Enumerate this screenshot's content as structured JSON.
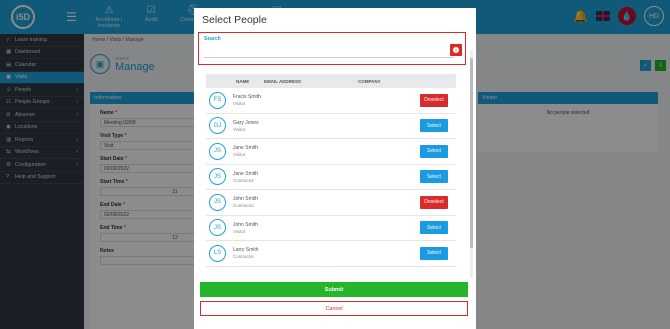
{
  "topbar": {
    "logo": "i5D",
    "nav": [
      {
        "icon": "accident-icon",
        "label": "Accidents / Incidents"
      },
      {
        "icon": "audit-icon",
        "label": "Audit"
      },
      {
        "icon": "contractor-icon",
        "label": "Contractor"
      },
      {
        "icon": "people-icon",
        "label": ""
      },
      {
        "icon": "chart-icon",
        "label": ""
      }
    ],
    "avatar": "HD"
  },
  "sidebar": {
    "items": [
      {
        "icon": "graduation-cap-icon",
        "label": "Learn training",
        "active": false,
        "caret": false
      },
      {
        "icon": "dashboard-icon",
        "label": "Dashboard",
        "active": false,
        "caret": false
      },
      {
        "icon": "calendar-icon",
        "label": "Calendar",
        "active": false,
        "caret": false
      },
      {
        "icon": "visits-icon",
        "label": "Visits",
        "active": true,
        "caret": false
      },
      {
        "icon": "people-icon",
        "label": "People",
        "active": false,
        "caret": true
      },
      {
        "icon": "people-groups-icon",
        "label": "People Groups",
        "active": false,
        "caret": true
      },
      {
        "icon": "absence-icon",
        "label": "Absence",
        "active": false,
        "caret": true
      },
      {
        "icon": "location-icon",
        "label": "Locations",
        "active": false,
        "caret": false
      },
      {
        "icon": "reports-icon",
        "label": "Reports",
        "active": false,
        "caret": true
      },
      {
        "icon": "workflow-icon",
        "label": "Workflows",
        "active": false,
        "caret": true
      },
      {
        "icon": "configuration-icon",
        "label": "Configuration",
        "active": false,
        "caret": true
      },
      {
        "icon": "help-icon",
        "label": "Help and Support",
        "active": false,
        "caret": false
      }
    ]
  },
  "breadcrumb": "Home / Visits / Manage",
  "page": {
    "subtitle": "VISITS",
    "title": "Manage"
  },
  "info_panel": {
    "header": "Information",
    "fields": [
      {
        "label": "Name",
        "required": true,
        "value": "Meeting 02/09"
      },
      {
        "label": "Visit Type",
        "required": true,
        "value": "Visit"
      },
      {
        "label": "Start Date",
        "required": true,
        "value": "02/09/2022"
      },
      {
        "label": "Start Time",
        "required": true,
        "value": "11"
      },
      {
        "label": "End Date",
        "required": true,
        "value": "02/09/2022"
      },
      {
        "label": "End Time",
        "required": true,
        "value": "12"
      },
      {
        "label": "Notes",
        "required": false,
        "value": ""
      }
    ]
  },
  "visitors_panel": {
    "header": "Visitor",
    "empty_text": "No people selected"
  },
  "modal": {
    "title": "Select People",
    "search": {
      "label": "Search",
      "placeholder": "",
      "value": ""
    },
    "columns": [
      "NAME",
      "EMAIL ADDRESS",
      "COMPANY"
    ],
    "people": [
      {
        "initials": "FS",
        "name": "Fracis Smith",
        "role": "Visitor",
        "action": "Deselect"
      },
      {
        "initials": "GJ",
        "name": "Gary Jones",
        "role": "Visitor",
        "action": "Select"
      },
      {
        "initials": "JS",
        "name": "Jane Smith",
        "role": "Visitor",
        "action": "Select"
      },
      {
        "initials": "JS",
        "name": "Jane Smith",
        "role": "Contractor",
        "action": "Select"
      },
      {
        "initials": "JS",
        "name": "John Smith",
        "role": "Contractor",
        "action": "Deselect"
      },
      {
        "initials": "JS",
        "name": "John Smith",
        "role": "Visitor",
        "action": "Select"
      },
      {
        "initials": "LS",
        "name": "Larry Smith",
        "role": "Contractor",
        "action": "Select"
      }
    ],
    "submit_label": "Submit",
    "cancel_label": "Cancel"
  },
  "colors": {
    "accent": "#1fa3dc",
    "danger": "#d92b2b",
    "success": "#25b62a",
    "sidebar": "#2f3a44"
  }
}
